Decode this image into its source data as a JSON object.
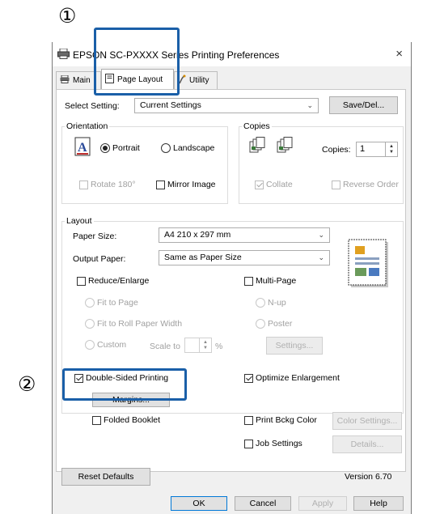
{
  "markers": {
    "step1": "①",
    "step2": "②"
  },
  "window": {
    "title": "EPSON SC-PXXXX Series Printing Preferences",
    "close_glyph": "×"
  },
  "tabs": [
    {
      "label": "Main",
      "icon": "printer-icon"
    },
    {
      "label": "Page Layout",
      "icon": "page-icon"
    },
    {
      "label": "Utility",
      "icon": "utility-icon"
    }
  ],
  "select_setting": {
    "label": "Select Setting:",
    "value": "Current Settings",
    "button": "Save/Del..."
  },
  "orientation": {
    "title": "Orientation",
    "portrait": "Portrait",
    "landscape": "Landscape",
    "selected": "Portrait",
    "rotate180": "Rotate 180°",
    "mirror_image": "Mirror Image"
  },
  "copies": {
    "title": "Copies",
    "label": "Copies:",
    "value": "1",
    "collate": "Collate",
    "reverse_order": "Reverse Order"
  },
  "layout": {
    "title": "Layout",
    "paper_size_label": "Paper Size:",
    "paper_size_value": "A4 210 x 297 mm",
    "output_paper_label": "Output Paper:",
    "output_paper_value": "Same as Paper Size",
    "reduce_enlarge": "Reduce/Enlarge",
    "fit_to_page": "Fit to Page",
    "fit_to_roll": "Fit to Roll Paper Width",
    "custom": "Custom",
    "scale_to": "Scale to",
    "percent": "%",
    "multi_page": "Multi-Page",
    "n_up": "N-up",
    "poster": "Poster",
    "settings_button": "Settings..."
  },
  "double_sided": {
    "label": "Double-Sided Printing",
    "checked": true
  },
  "margins_button": "Margins...",
  "folded_booklet": "Folded Booklet",
  "optimize_enlargement": {
    "label": "Optimize Enlargement",
    "checked": true
  },
  "print_bckg_color": "Print Bckg Color",
  "color_settings_button": "Color Settings...",
  "job_settings": "Job Settings",
  "details_button": "Details...",
  "reset_defaults": "Reset Defaults",
  "version": "Version 6.70",
  "footer": {
    "ok": "OK",
    "cancel": "Cancel",
    "apply": "Apply",
    "help": "Help"
  },
  "colors": {
    "highlight": "#1a5fa8"
  }
}
